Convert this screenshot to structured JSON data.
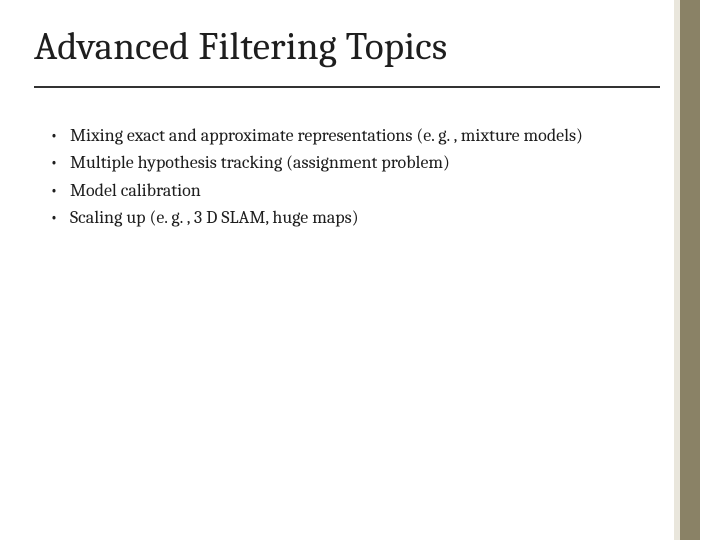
{
  "slide": {
    "title": "Advanced Filtering Topics",
    "bullets": [
      "Mixing exact and approximate representations (e. g. , mixture models)",
      "Multiple hypothesis tracking (assignment problem)",
      "Model calibration",
      "Scaling up (e. g. , 3 D SLAM, huge maps)"
    ]
  }
}
